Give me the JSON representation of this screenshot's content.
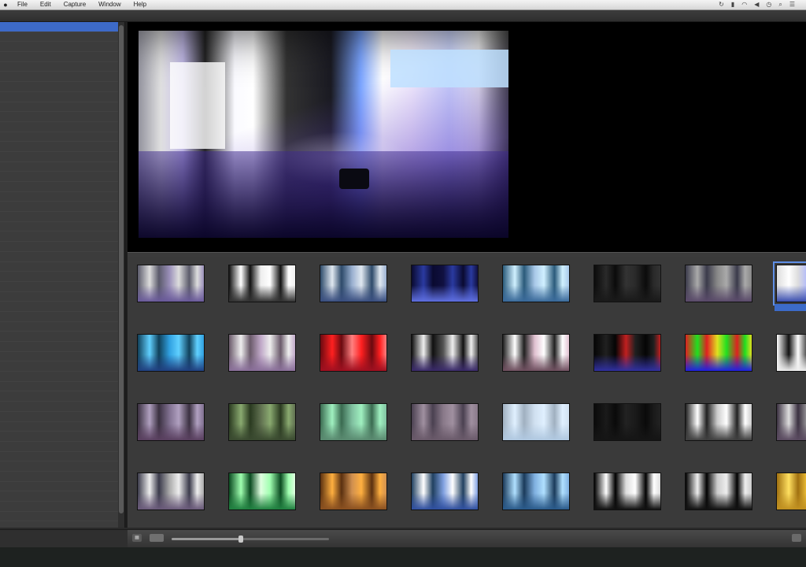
{
  "menubar": {
    "items": [
      "File",
      "Edit",
      "Capture",
      "Window",
      "Help"
    ],
    "tray_icons": [
      "sync-icon",
      "battery-icon",
      "wifi-icon",
      "volume-icon",
      "clock-icon",
      "search-icon",
      "menu-icon"
    ]
  },
  "window": {
    "title": ""
  },
  "sidebar": {
    "selected_index": 0,
    "rows": [
      "",
      "",
      "",
      "",
      "",
      "",
      "",
      "",
      "",
      "",
      "",
      "",
      "",
      "",
      "",
      "",
      "",
      "",
      "",
      "",
      "",
      "",
      "",
      "",
      "",
      "",
      "",
      "",
      "",
      "",
      "",
      "",
      "",
      "",
      "",
      "",
      "",
      "",
      "",
      "",
      "",
      "",
      "",
      "",
      "",
      "",
      "",
      "",
      "",
      "",
      "",
      "",
      "",
      ""
    ]
  },
  "viewer": {
    "clip_name": "",
    "meta_lines": [
      "",
      ""
    ],
    "tags_title": "",
    "tags": [
      "",
      "",
      "",
      "",
      ""
    ]
  },
  "grid": {
    "selected_index": 7,
    "tiles": [
      {
        "label": "",
        "colors": [
          "#5a5a6a",
          "#ddd",
          "#6a5a9a",
          "#9a8fb9"
        ]
      },
      {
        "label": "",
        "colors": [
          "#111",
          "#fff",
          "#333",
          "#eee"
        ]
      },
      {
        "label": "",
        "colors": [
          "#2d4a6a",
          "#e0e8f0",
          "#3a4f80",
          "#9ab0d0"
        ]
      },
      {
        "label": "",
        "colors": [
          "#0a0a30",
          "#2a3aa0",
          "#6070e0",
          "#101040"
        ]
      },
      {
        "label": "",
        "colors": [
          "#2a5a7a",
          "#d0f0ff",
          "#3a6a9a",
          "#a8c8e8"
        ]
      },
      {
        "label": "",
        "colors": [
          "#0b0b0b",
          "#2a2a2a",
          "#1a1a1a",
          "#333"
        ]
      },
      {
        "label": "",
        "colors": [
          "#3a3a4a",
          "#aaa",
          "#5a4a6a",
          "#888"
        ]
      },
      {
        "label": "",
        "colors": [
          "#ddd",
          "#fff",
          "#3b4fb0",
          "#aab4ff"
        ]
      },
      {
        "label": "",
        "colors": [
          "#10405a",
          "#60d0ff",
          "#204080",
          "#30a0e0"
        ]
      },
      {
        "label": "",
        "colors": [
          "#6a5a6a",
          "#eee",
          "#8a6f9a",
          "#c0a8c8"
        ]
      },
      {
        "label": "",
        "colors": [
          "#6a0a10",
          "#ff2020",
          "#a01020",
          "#ff8080"
        ]
      },
      {
        "label": "",
        "colors": [
          "#101010",
          "#eee",
          "#3a2a6a",
          "#555"
        ]
      },
      {
        "label": "",
        "colors": [
          "#202020",
          "#fff",
          "#705060",
          "#e0c0d0"
        ]
      },
      {
        "label": "",
        "colors": [
          "#050505",
          "#202020",
          "#3030a0",
          "#c02020"
        ]
      },
      {
        "label": "",
        "colors": [
          "#e02020",
          "#20e020",
          "#2020e0",
          "#e0e020"
        ]
      },
      {
        "label": "",
        "colors": [
          "#fff",
          "#111",
          "#eee",
          "#222"
        ]
      },
      {
        "label": "",
        "colors": [
          "#3a3040",
          "#b0a0c0",
          "#5a4060",
          "#807090"
        ]
      },
      {
        "label": "",
        "colors": [
          "#2a3a20",
          "#8aaa70",
          "#3a4a30",
          "#607050"
        ]
      },
      {
        "label": "",
        "colors": [
          "#3a6a50",
          "#a0f0c0",
          "#5a8a70",
          "#80c0a0"
        ]
      },
      {
        "label": "",
        "colors": [
          "#4a4050",
          "#a090a0",
          "#6a5a6a",
          "#8a7a8a"
        ]
      },
      {
        "label": "",
        "colors": [
          "#a0b0c0",
          "#e0f0ff",
          "#b0c8e0",
          "#d0e0f0"
        ]
      },
      {
        "label": "",
        "colors": [
          "#0a0a0a",
          "#1a1a1a",
          "#151515",
          "#222"
        ]
      },
      {
        "label": "",
        "colors": [
          "#202020",
          "#fff",
          "#404040",
          "#ccc"
        ]
      },
      {
        "label": "",
        "colors": [
          "#3a3040",
          "#ddd",
          "#5a4a60",
          "#aaa"
        ]
      },
      {
        "label": "",
        "colors": [
          "#3a3a4a",
          "#eee",
          "#6a5a7a",
          "#aaa"
        ]
      },
      {
        "label": "",
        "colors": [
          "#0a4a20",
          "#a0ffb0",
          "#208040",
          "#e0ffe0"
        ]
      },
      {
        "label": "",
        "colors": [
          "#5a3010",
          "#ffb040",
          "#8a5020",
          "#d09050"
        ]
      },
      {
        "label": "",
        "colors": [
          "#204060",
          "#fff",
          "#3050a0",
          "#80a0e0"
        ]
      },
      {
        "label": "",
        "colors": [
          "#1a3a5a",
          "#b0e0ff",
          "#2a5a8a",
          "#80b0e0"
        ]
      },
      {
        "label": "",
        "colors": [
          "#000",
          "#fff",
          "#111",
          "#ddd"
        ]
      },
      {
        "label": "",
        "colors": [
          "#000",
          "#eee",
          "#111",
          "#ccc"
        ]
      },
      {
        "label": "",
        "colors": [
          "#a07010",
          "#ffe060",
          "#c09020",
          "#ffd040"
        ]
      }
    ]
  },
  "bottombar": {
    "zoom_fraction": 0.44
  }
}
